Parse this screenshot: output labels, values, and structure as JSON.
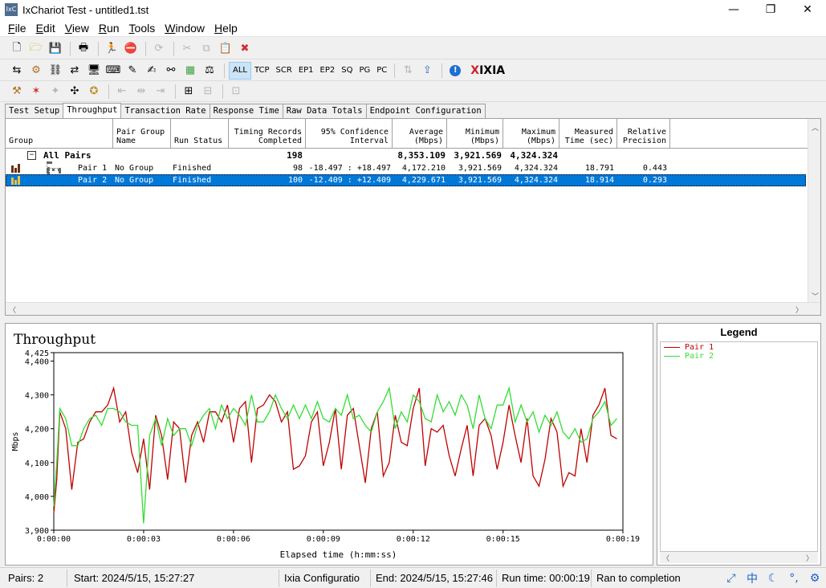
{
  "window": {
    "title": "IxChariot Test - untitled1.tst",
    "app_icon_text": "IxC",
    "minimize_glyph": "—",
    "maximize_glyph": "❐",
    "close_glyph": "✕"
  },
  "menu": [
    {
      "key": "F",
      "rest": "ile"
    },
    {
      "key": "E",
      "rest": "dit"
    },
    {
      "key": "V",
      "rest": "iew"
    },
    {
      "key": "R",
      "rest": "un"
    },
    {
      "key": "T",
      "rest": "ools"
    },
    {
      "key": "W",
      "rest": "indow"
    },
    {
      "key": "H",
      "rest": "elp"
    }
  ],
  "toolbar2_labels": [
    "ALL",
    "TCP",
    "SCR",
    "EP1",
    "EP2",
    "SQ",
    "PG",
    "PC"
  ],
  "ixia_logo": {
    "x": "X",
    "rest": "IXIA"
  },
  "tabs": [
    "Test Setup",
    "Throughput",
    "Transaction Rate",
    "Response Time",
    "Raw Data Totals",
    "Endpoint Configuration"
  ],
  "active_tab": "Throughput",
  "grid": {
    "columns": [
      {
        "label": "Group",
        "align": "left"
      },
      {
        "label": "Pair Group\nName",
        "align": "left"
      },
      {
        "label": "Run Status",
        "align": "left"
      },
      {
        "label": "Timing Records\nCompleted",
        "align": "right"
      },
      {
        "label": "95% Confidence\nInterval",
        "align": "right"
      },
      {
        "label": "Average\n(Mbps)",
        "align": "right"
      },
      {
        "label": "Minimum\n(Mbps)",
        "align": "right"
      },
      {
        "label": "Maximum\n(Mbps)",
        "align": "right"
      },
      {
        "label": "Measured\nTime (sec)",
        "align": "right"
      },
      {
        "label": "Relative\nPrecision",
        "align": "right"
      }
    ],
    "summary": {
      "group": "All Pairs",
      "expander": "−",
      "records": "198",
      "average": "8,353.109",
      "minimum": "3,921.569",
      "maximum": "4,324.324"
    },
    "rows": [
      {
        "name": "Pair 1",
        "group": "No Group",
        "status": "Finished",
        "records": "98",
        "ci": "-18.497 : +18.497",
        "average": "4,172.210",
        "minimum": "3,921.569",
        "maximum": "4,324.324",
        "time": "18.791",
        "precision": "0.443"
      },
      {
        "name": "Pair 2",
        "group": "No Group",
        "status": "Finished",
        "records": "100",
        "ci": "-12.409 : +12.409",
        "average": "4,229.671",
        "minimum": "3,921.569",
        "maximum": "4,324.324",
        "time": "18.914",
        "precision": "0.293"
      }
    ]
  },
  "legend": {
    "title": "Legend",
    "items": [
      {
        "name": "Pair 1",
        "color": "#c00000"
      },
      {
        "name": "Pair 2",
        "color": "#33dd33"
      }
    ]
  },
  "status": {
    "pairs": "Pairs: 2",
    "start": "Start: 2024/5/15, 15:27:27",
    "config": "Ixia Configuratio",
    "end": "End: 2024/5/15, 15:27:46",
    "runtime": "Run time: 00:00:19",
    "result": "Ran to completion",
    "ime_glyphs": [
      "⤢",
      "中",
      "☾",
      "°,",
      "⚙"
    ]
  },
  "chart_data": {
    "type": "line",
    "title": "Throughput",
    "xlabel": "Elapsed time (h:mm:ss)",
    "ylabel": "Mbps",
    "xlim": [
      0,
      19
    ],
    "ylim": [
      3900,
      4425
    ],
    "x_ticks": [
      0,
      3,
      6,
      9,
      12,
      15,
      19
    ],
    "x_tick_labels": [
      "0:00:00",
      "0:00:03",
      "0:00:06",
      "0:00:09",
      "0:00:12",
      "0:00:15",
      "0:00:19"
    ],
    "y_ticks": [
      3900,
      4000,
      4100,
      4200,
      4300,
      4400,
      4425
    ],
    "y_tick_labels": [
      "3,900",
      "4,000",
      "4,100",
      "4,200",
      "4,300",
      "4,400",
      "4,425"
    ],
    "grid": false,
    "series": [
      {
        "name": "Pair 1",
        "color": "#c00000",
        "x": [
          0,
          0.1,
          0.2,
          0.4,
          0.6,
          0.8,
          1.0,
          1.2,
          1.4,
          1.6,
          1.8,
          2.0,
          2.2,
          2.4,
          2.6,
          2.8,
          3.0,
          3.2,
          3.4,
          3.6,
          3.8,
          4.0,
          4.2,
          4.4,
          4.6,
          4.8,
          5.0,
          5.2,
          5.4,
          5.6,
          5.8,
          6.0,
          6.2,
          6.4,
          6.6,
          6.8,
          7.0,
          7.2,
          7.4,
          7.6,
          7.8,
          8.0,
          8.2,
          8.4,
          8.6,
          8.8,
          9.0,
          9.2,
          9.4,
          9.6,
          9.8,
          10.0,
          10.2,
          10.4,
          10.6,
          10.8,
          11.0,
          11.2,
          11.4,
          11.6,
          11.8,
          12.0,
          12.2,
          12.4,
          12.6,
          12.8,
          13.0,
          13.2,
          13.4,
          13.6,
          13.8,
          14.0,
          14.2,
          14.4,
          14.6,
          14.8,
          15.0,
          15.2,
          15.4,
          15.6,
          15.8,
          16.0,
          16.2,
          16.4,
          16.6,
          16.8,
          17.0,
          17.2,
          17.4,
          17.6,
          17.8,
          18.0,
          18.2,
          18.4,
          18.6,
          18.8
        ],
        "values": [
          3950,
          4050,
          4250,
          4200,
          4020,
          4160,
          4170,
          4220,
          4250,
          4250,
          4270,
          4320,
          4220,
          4250,
          4130,
          4070,
          4170,
          4020,
          4240,
          4180,
          4050,
          4220,
          4200,
          4040,
          4180,
          4220,
          4160,
          4250,
          4250,
          4220,
          4270,
          4160,
          4260,
          4280,
          4100,
          4260,
          4270,
          4300,
          4280,
          4220,
          4250,
          4080,
          4090,
          4120,
          4220,
          4250,
          4090,
          4160,
          4260,
          4080,
          4240,
          4260,
          4150,
          4040,
          4200,
          4250,
          4060,
          4100,
          4240,
          4160,
          4150,
          4260,
          4320,
          4090,
          4200,
          4190,
          4210,
          4120,
          4060,
          4140,
          4210,
          4060,
          4210,
          4230,
          4180,
          4080,
          4160,
          4270,
          4180,
          4100,
          4230,
          4060,
          4030,
          4110,
          4230,
          4190,
          4030,
          4070,
          4060,
          4200,
          4100,
          4240,
          4270,
          4320,
          4180,
          4170
        ],
        "note": "values approximated from plot"
      },
      {
        "name": "Pair 2",
        "color": "#33dd33",
        "x": [
          0,
          0.1,
          0.2,
          0.4,
          0.6,
          0.8,
          1.0,
          1.2,
          1.4,
          1.6,
          1.8,
          2.0,
          2.2,
          2.4,
          2.6,
          2.8,
          3.0,
          3.2,
          3.4,
          3.6,
          3.8,
          4.0,
          4.2,
          4.4,
          4.6,
          4.8,
          5.0,
          5.2,
          5.4,
          5.6,
          5.8,
          6.0,
          6.2,
          6.4,
          6.6,
          6.8,
          7.0,
          7.2,
          7.4,
          7.6,
          7.8,
          8.0,
          8.2,
          8.4,
          8.6,
          8.8,
          9.0,
          9.2,
          9.4,
          9.6,
          9.8,
          10.0,
          10.2,
          10.4,
          10.6,
          10.8,
          11.0,
          11.2,
          11.4,
          11.6,
          11.8,
          12.0,
          12.2,
          12.4,
          12.6,
          12.8,
          13.0,
          13.2,
          13.4,
          13.6,
          13.8,
          14.0,
          14.2,
          14.4,
          14.6,
          14.8,
          15.0,
          15.2,
          15.4,
          15.6,
          15.8,
          16.0,
          16.2,
          16.4,
          16.6,
          16.8,
          17.0,
          17.2,
          17.4,
          17.6,
          17.8,
          18.0,
          18.2,
          18.4,
          18.6,
          18.8
        ],
        "values": [
          3970,
          4100,
          4260,
          4230,
          4150,
          4150,
          4200,
          4230,
          4240,
          4210,
          4260,
          4260,
          4250,
          4220,
          4210,
          4210,
          3920,
          4180,
          4230,
          4150,
          4230,
          4180,
          4200,
          4200,
          4150,
          4210,
          4240,
          4260,
          4200,
          4270,
          4230,
          4260,
          4240,
          4210,
          4300,
          4220,
          4220,
          4250,
          4300,
          4260,
          4230,
          4270,
          4230,
          4270,
          4230,
          4280,
          4230,
          4220,
          4260,
          4240,
          4300,
          4230,
          4240,
          4210,
          4190,
          4250,
          4280,
          4320,
          4200,
          4250,
          4220,
          4300,
          4280,
          4230,
          4220,
          4300,
          4250,
          4280,
          4240,
          4300,
          4270,
          4200,
          4300,
          4230,
          4200,
          4270,
          4270,
          4320,
          4220,
          4270,
          4220,
          4250,
          4190,
          4240,
          4210,
          4250,
          4190,
          4170,
          4200,
          4160,
          4170,
          4230,
          4250,
          4280,
          4210,
          4230
        ],
        "note": "values approximated from plot"
      }
    ]
  }
}
